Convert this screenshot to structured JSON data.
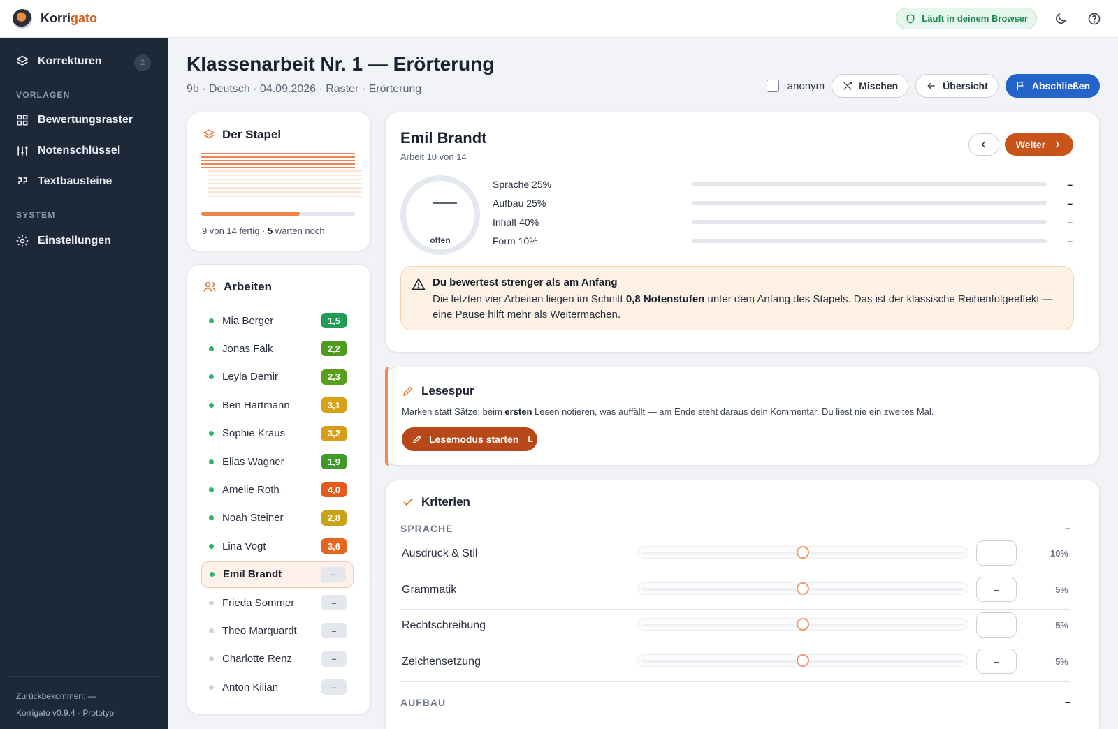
{
  "app": {
    "brand_part1": "Korri",
    "brand_part2": "gato",
    "browser_badge": "Läuft in deinem Browser"
  },
  "sidebar": {
    "korrekturen": {
      "label": "Korrekturen",
      "count": "2"
    },
    "section_vorlagen": "VORLAGEN",
    "items": [
      {
        "label": "Bewertungsraster",
        "icon": "grid-icon"
      },
      {
        "label": "Notenschlüssel",
        "icon": "sliders-icon"
      },
      {
        "label": "Textbausteine",
        "icon": "quote-icon"
      }
    ],
    "section_system": "SYSTEM",
    "settings": {
      "label": "Einstellungen",
      "icon": "gear-icon"
    },
    "footer_line1": "Zurückbekommen: —",
    "footer_line2": "Korrigato v0.9.4 · Prototyp"
  },
  "header": {
    "title": "Klassenarbeit Nr. 1 — Erörterung",
    "subtitle": "9b · Deutsch · 04.09.2026 · Raster · Erörterung",
    "anonym_label": "anonym",
    "shuffle_label": "Mischen",
    "overview_label": "Übersicht",
    "finish_label": "Abschließen"
  },
  "stack": {
    "title": "Der Stapel",
    "progress": 0.64,
    "text_done": "9 von 14 fertig · ",
    "text_waiting_count": "5",
    "text_waiting_label": " warten noch"
  },
  "works": {
    "title": "Arbeiten",
    "items": [
      {
        "name": "Mia Berger",
        "grade": "1,5",
        "color": "#1f9d55",
        "status": "done"
      },
      {
        "name": "Jonas Falk",
        "grade": "2,2",
        "color": "#4e9a1f",
        "status": "done"
      },
      {
        "name": "Leyla Demir",
        "grade": "2,3",
        "color": "#5a9f1c",
        "status": "done"
      },
      {
        "name": "Ben Hartmann",
        "grade": "3,1",
        "color": "#d9a114",
        "status": "done"
      },
      {
        "name": "Sophie Kraus",
        "grade": "3,2",
        "color": "#d89c16",
        "status": "done"
      },
      {
        "name": "Elias Wagner",
        "grade": "1,9",
        "color": "#3f9a2a",
        "status": "done"
      },
      {
        "name": "Amelie Roth",
        "grade": "4,0",
        "color": "#e35a1c",
        "status": "done"
      },
      {
        "name": "Noah Steiner",
        "grade": "2,8",
        "color": "#c9a317",
        "status": "done"
      },
      {
        "name": "Lina Vogt",
        "grade": "3,6",
        "color": "#e4661f",
        "status": "done"
      },
      {
        "name": "Emil Brandt",
        "grade": "–",
        "color": "",
        "status": "active"
      },
      {
        "name": "Frieda Sommer",
        "grade": "–",
        "color": "",
        "status": "pending"
      },
      {
        "name": "Theo Marquardt",
        "grade": "–",
        "color": "",
        "status": "pending"
      },
      {
        "name": "Charlotte Renz",
        "grade": "–",
        "color": "",
        "status": "pending"
      },
      {
        "name": "Anton Kilian",
        "grade": "–",
        "color": "",
        "status": "pending"
      }
    ]
  },
  "student": {
    "name": "Emil Brandt",
    "sub": "Arbeit 10 von 14",
    "next_label": "Weiter",
    "ring_label": "offen",
    "criteria": [
      {
        "label": "Sprache 25%",
        "value": "–"
      },
      {
        "label": "Aufbau 25%",
        "value": "–"
      },
      {
        "label": "Inhalt 40%",
        "value": "–"
      },
      {
        "label": "Form 10%",
        "value": "–"
      }
    ],
    "warning": {
      "title": "Du bewertest strenger als am Anfang",
      "body_pre": "Die letzten vier Arbeiten liegen im Schnitt ",
      "body_bold": "0,8 Notenstufen",
      "body_post": " unter dem Anfang des Stapels. Das ist der klassische Reihenfolgeeffekt — eine Pause hilft mehr als Weitermachen."
    }
  },
  "lesespur": {
    "title": "Lesespur",
    "text_pre": "Marken statt Sätze: beim ",
    "text_bold": "ersten",
    "text_post": " Lesen notieren, was auffällt — am Ende steht daraus dein Kommentar. Du liest nie ein zweites Mal.",
    "button_label": "Lesemodus starten",
    "shortcut": "L"
  },
  "kriterien": {
    "title": "Kriterien",
    "group1": {
      "label": "SPRACHE",
      "value": "–"
    },
    "rows": [
      {
        "label": "Ausdruck & Stil",
        "value": "–",
        "weight": "10%",
        "slider": 0.5
      },
      {
        "label": "Grammatik",
        "value": "–",
        "weight": "5%",
        "slider": 0.5
      },
      {
        "label": "Rechtschreibung",
        "value": "–",
        "weight": "5%",
        "slider": 0.5
      },
      {
        "label": "Zeichensetzung",
        "value": "–",
        "weight": "5%",
        "slider": 0.5
      }
    ],
    "group2": {
      "label": "AUFBAU",
      "value": "–"
    }
  }
}
